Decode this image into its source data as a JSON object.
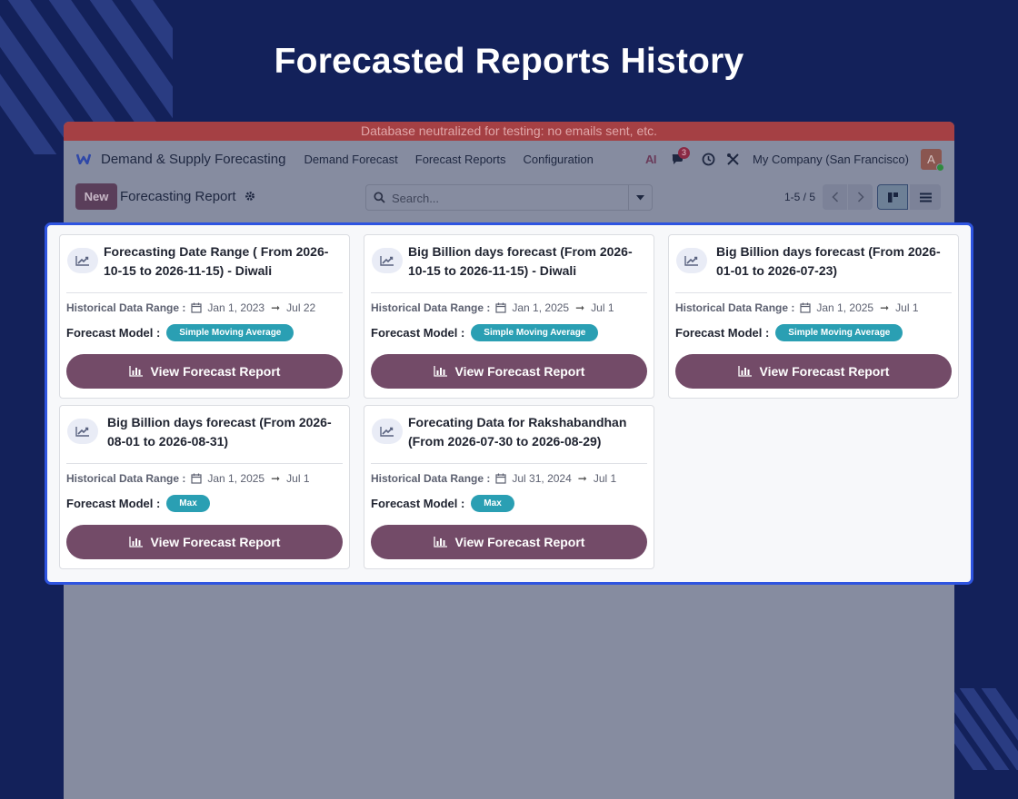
{
  "heading": "Forecasted Reports History",
  "banner": "Database neutralized for testing: no emails sent, etc.",
  "navbar": {
    "brand": "Demand & Supply Forecasting",
    "menu": [
      "Demand Forecast",
      "Forecast Reports",
      "Configuration"
    ],
    "ai_label": "AI",
    "chat_count": "3",
    "company": "My Company (San Francisco)",
    "avatar_initial": "A"
  },
  "control": {
    "new_label": "New",
    "breadcrumb": "Forecasting Report",
    "search_placeholder": "Search...",
    "pager": "1-5 / 5"
  },
  "labels": {
    "historical": "Historical Data Range :",
    "model": "Forecast Model :",
    "view_button": "View Forecast Report",
    "arrow": "➞"
  },
  "cards": [
    {
      "title": "Forecasting Date Range ( From 2026-10-15 to 2026-11-15) - Diwali",
      "from": "Jan 1, 2023",
      "to": "Jul 22",
      "model": "Simple Moving Average"
    },
    {
      "title": "Big Billion days forecast (From 2026-10-15 to 2026-11-15) - Diwali",
      "from": "Jan 1, 2025",
      "to": "Jul 1",
      "model": "Simple Moving Average"
    },
    {
      "title": "Big Billion days forecast (From 2026-01-01 to 2026-07-23)",
      "from": "Jan 1, 2025",
      "to": "Jul 1",
      "model": "Simple Moving Average"
    },
    {
      "title": "Big Billion days forecast (From 2026-08-01 to 2026-08-31)",
      "from": "Jan 1, 2025",
      "to": "Jul 1",
      "model": "Max"
    },
    {
      "title": "Forecating Data for Rakshabandhan (From 2026-07-30 to 2026-08-29)",
      "from": "Jul 31, 2024",
      "to": "Jul 1",
      "model": "Max"
    }
  ],
  "colors": {
    "background": "#13215a",
    "banner": "#a54044",
    "accent": "#734b68",
    "pill": "#2a9fb3",
    "panel_border": "#2e54e0"
  }
}
